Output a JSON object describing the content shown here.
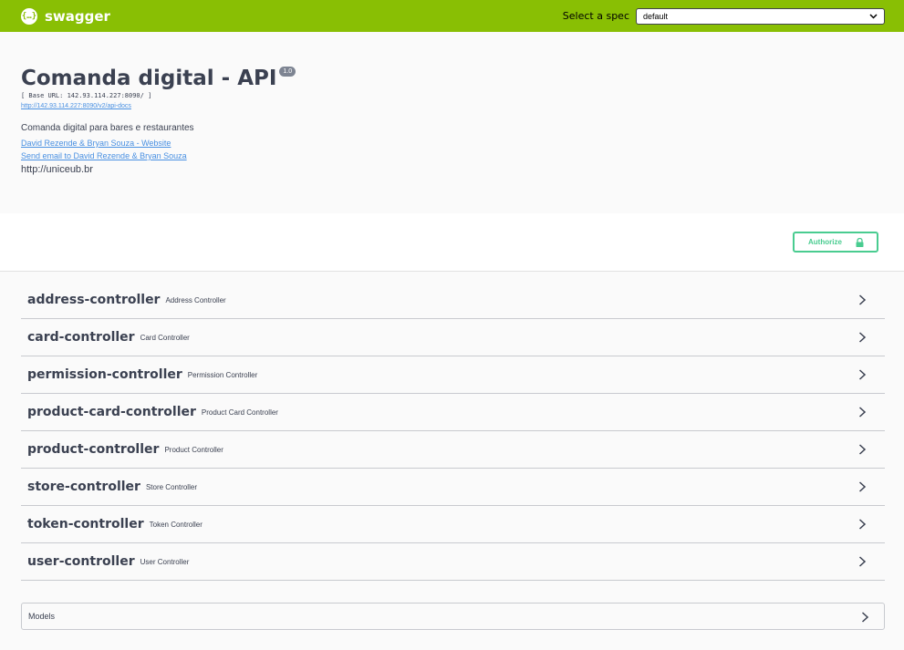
{
  "topbar": {
    "logo_glyph": "{…}",
    "logo_text": "swagger",
    "spec_label": "Select a spec",
    "spec_value": "default"
  },
  "info": {
    "title": "Comanda digital - API",
    "version": "1.0",
    "base_url": "[ Base URL: 142.93.114.227:8090/ ]",
    "docs_link": "http://142.93.114.227:8090/v2/api-docs",
    "description": "Comanda digital para bares e restaurantes",
    "contact_website": "David Rezende & Bryan Souza - Website",
    "contact_email": "Send email to David Rezende & Bryan Souza",
    "terms": "http://uniceub.br"
  },
  "auth": {
    "authorize_label": "Authorize"
  },
  "tags": [
    {
      "name": "address-controller",
      "description": "Address Controller"
    },
    {
      "name": "card-controller",
      "description": "Card Controller"
    },
    {
      "name": "permission-controller",
      "description": "Permission Controller"
    },
    {
      "name": "product-card-controller",
      "description": "Product Card Controller"
    },
    {
      "name": "product-controller",
      "description": "Product Controller"
    },
    {
      "name": "store-controller",
      "description": "Store Controller"
    },
    {
      "name": "token-controller",
      "description": "Token Controller"
    },
    {
      "name": "user-controller",
      "description": "User Controller"
    }
  ],
  "models": {
    "label": "Models"
  },
  "colors": {
    "topbar": "#89bf04",
    "authorize": "#49cc90",
    "link": "#4990e2",
    "text": "#3b4151"
  }
}
